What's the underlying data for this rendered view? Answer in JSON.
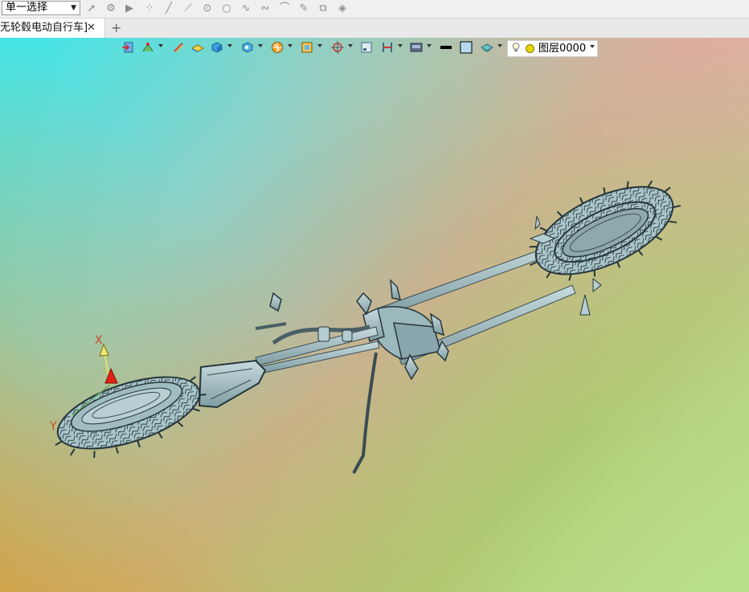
{
  "toolbar": {
    "selection_mode": "单一选择",
    "icons": [
      "pointer-icon",
      "filter-icon",
      "play-icon",
      "points-icon",
      "line-icon",
      "segment-icon",
      "circle-center-icon",
      "circle-icon",
      "curve-icon",
      "spline-icon",
      "arc-icon",
      "pen-icon",
      "stack-icon",
      "layers-icon"
    ]
  },
  "tabs": [
    {
      "label": "无轮毂电动自行车]",
      "close": "✕"
    }
  ],
  "new_tab": "+",
  "view_toolbar": {
    "layer": "图层0000"
  },
  "axis": {
    "x_label": "X",
    "y_label": "Y"
  },
  "colors": {
    "model_fill": "#a3c2c6",
    "model_edge": "#2b3a40",
    "axis_x": "#d12b1a",
    "layer_dot": "#e9d600"
  }
}
